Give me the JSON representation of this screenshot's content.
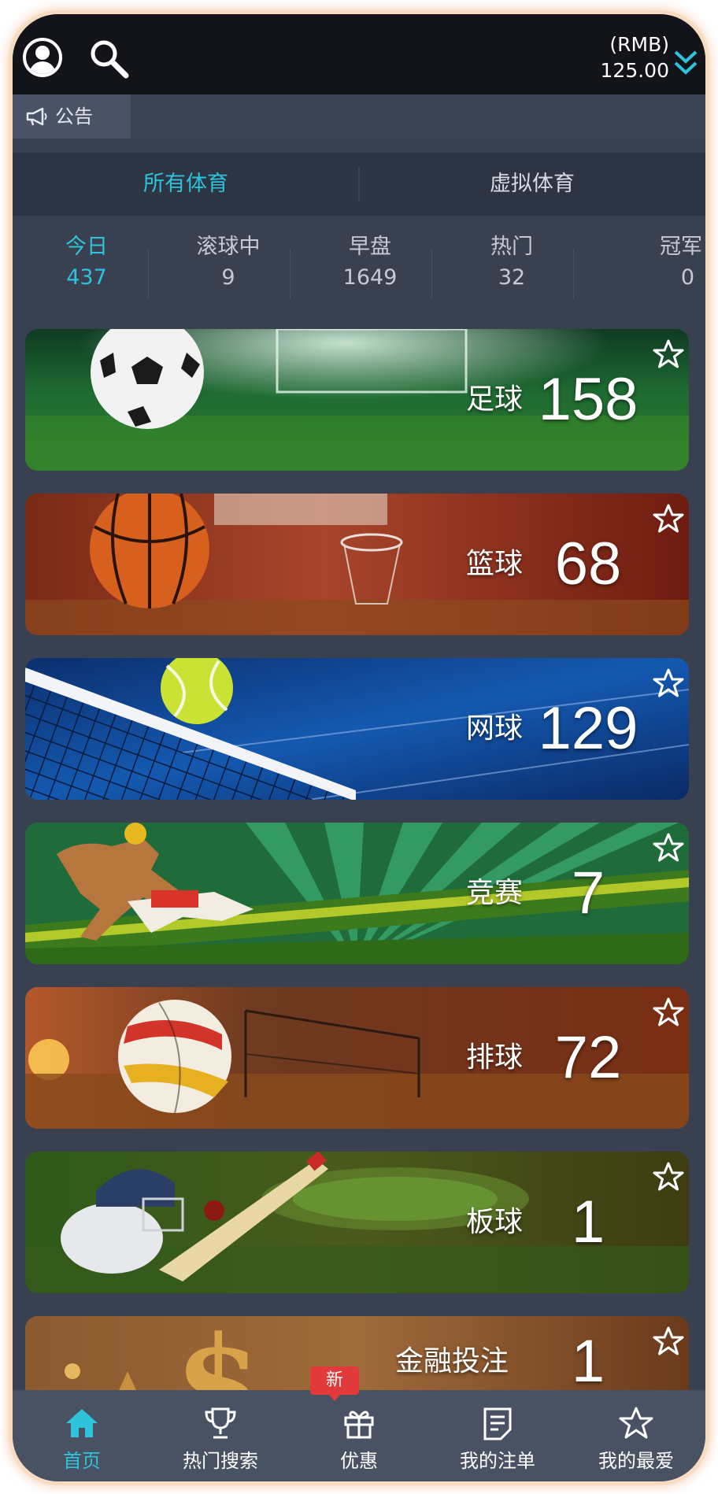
{
  "header": {
    "currency": "(RMB)",
    "balance": "125.00"
  },
  "notice": {
    "label": "公告"
  },
  "sport_type_tabs": [
    {
      "label": "所有体育",
      "active": true
    },
    {
      "label": "虚拟体育",
      "active": false
    }
  ],
  "market_tabs": [
    {
      "label": "今日",
      "count": "437",
      "active": true
    },
    {
      "label": "滚球中",
      "count": "9",
      "active": false
    },
    {
      "label": "早盘",
      "count": "1649",
      "active": false
    },
    {
      "label": "热门",
      "count": "32",
      "active": false
    },
    {
      "label": "冠军",
      "count": "0",
      "active": false
    }
  ],
  "sports": [
    {
      "name": "足球",
      "count": "158",
      "icon": "soccer-ball-icon"
    },
    {
      "name": "篮球",
      "count": "68",
      "icon": "basketball-icon"
    },
    {
      "name": "网球",
      "count": "129",
      "icon": "tennis-ball-icon"
    },
    {
      "name": "竞赛",
      "count": "7",
      "icon": "horse-racing-icon"
    },
    {
      "name": "排球",
      "count": "72",
      "icon": "volleyball-icon"
    },
    {
      "name": "板球",
      "count": "1",
      "icon": "cricket-icon"
    },
    {
      "name": "金融投注",
      "count": "1",
      "icon": "finance-icon"
    }
  ],
  "bottom_nav": [
    {
      "label": "首页",
      "icon": "home-icon",
      "active": true
    },
    {
      "label": "热门搜索",
      "icon": "trophy-icon",
      "active": false
    },
    {
      "label": "优惠",
      "icon": "gift-icon",
      "active": false,
      "badge": "新"
    },
    {
      "label": "我的注单",
      "icon": "document-icon",
      "active": false
    },
    {
      "label": "我的最爱",
      "icon": "star-icon",
      "active": false
    }
  ],
  "colors": {
    "accent": "#2ec3da",
    "background": "#394150",
    "header": "#12141a",
    "badge": "#e23a3a"
  }
}
